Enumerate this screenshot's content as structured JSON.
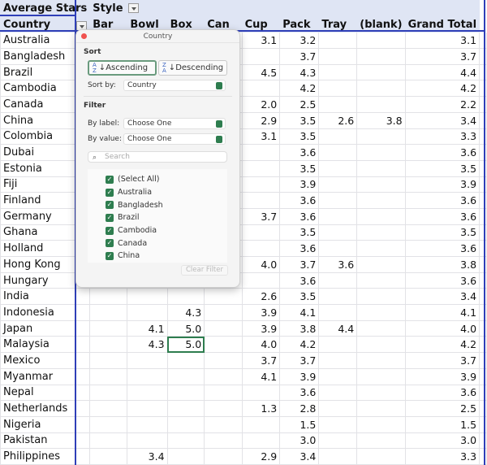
{
  "pivot": {
    "value_field": "Average Stars",
    "column_field": "Style",
    "row_field": "Country",
    "columns": [
      "Bar",
      "Bowl",
      "Box",
      "Can",
      "Cup",
      "Pack",
      "Tray",
      "(blank)",
      "Grand Total"
    ],
    "rows": [
      {
        "country": "Australia",
        "v": [
          "",
          "",
          "",
          "",
          "3.1",
          "3.2",
          "",
          "",
          "3.1"
        ]
      },
      {
        "country": "Bangladesh",
        "v": [
          "",
          "",
          "",
          "",
          "",
          "3.7",
          "",
          "",
          "3.7"
        ]
      },
      {
        "country": "Brazil",
        "v": [
          "",
          "",
          "",
          "",
          "4.5",
          "4.3",
          "",
          "",
          "4.4"
        ]
      },
      {
        "country": "Cambodia",
        "v": [
          "",
          "",
          "",
          "",
          "",
          "4.2",
          "",
          "",
          "4.2"
        ]
      },
      {
        "country": "Canada",
        "v": [
          "",
          "",
          "",
          "",
          "2.0",
          "2.5",
          "",
          "",
          "2.2"
        ]
      },
      {
        "country": "China",
        "v": [
          "",
          "",
          "",
          "",
          "2.9",
          "3.5",
          "2.6",
          "3.8",
          "3.4"
        ]
      },
      {
        "country": "Colombia",
        "v": [
          "",
          "",
          "",
          "",
          "3.1",
          "3.5",
          "",
          "",
          "3.3"
        ]
      },
      {
        "country": "Dubai",
        "v": [
          "",
          "",
          "",
          "",
          "",
          "3.6",
          "",
          "",
          "3.6"
        ]
      },
      {
        "country": "Estonia",
        "v": [
          "",
          "",
          "",
          "",
          "",
          "3.5",
          "",
          "",
          "3.5"
        ]
      },
      {
        "country": "Fiji",
        "v": [
          "",
          "",
          "",
          "",
          "",
          "3.9",
          "",
          "",
          "3.9"
        ]
      },
      {
        "country": "Finland",
        "v": [
          "",
          "",
          "",
          "",
          "",
          "3.6",
          "",
          "",
          "3.6"
        ]
      },
      {
        "country": "Germany",
        "v": [
          "",
          "",
          "",
          "",
          "3.7",
          "3.6",
          "",
          "",
          "3.6"
        ]
      },
      {
        "country": "Ghana",
        "v": [
          "",
          "",
          "",
          "",
          "",
          "3.5",
          "",
          "",
          "3.5"
        ]
      },
      {
        "country": "Holland",
        "v": [
          "",
          "",
          "",
          "",
          "",
          "3.6",
          "",
          "",
          "3.6"
        ]
      },
      {
        "country": "Hong Kong",
        "v": [
          "",
          "",
          "",
          "",
          "4.0",
          "3.7",
          "3.6",
          "",
          "3.8"
        ]
      },
      {
        "country": "Hungary",
        "v": [
          "",
          "",
          "",
          "",
          "",
          "3.6",
          "",
          "",
          "3.6"
        ]
      },
      {
        "country": "India",
        "v": [
          "",
          "",
          "",
          "",
          "2.6",
          "3.5",
          "",
          "",
          "3.4"
        ]
      },
      {
        "country": "Indonesia",
        "v": [
          "",
          "",
          "4.3",
          "",
          "3.9",
          "4.1",
          "",
          "",
          "4.1"
        ]
      },
      {
        "country": "Japan",
        "v": [
          "",
          "4.1",
          "5.0",
          "",
          "3.9",
          "3.8",
          "4.4",
          "",
          "4.0"
        ]
      },
      {
        "country": "Malaysia",
        "v": [
          "",
          "4.3",
          "5.0",
          "",
          "4.0",
          "4.2",
          "",
          "",
          "4.2"
        ]
      },
      {
        "country": "Mexico",
        "v": [
          "",
          "",
          "",
          "",
          "3.7",
          "3.7",
          "",
          "",
          "3.7"
        ]
      },
      {
        "country": "Myanmar",
        "v": [
          "",
          "",
          "",
          "",
          "4.1",
          "3.9",
          "",
          "",
          "3.9"
        ]
      },
      {
        "country": "Nepal",
        "v": [
          "",
          "",
          "",
          "",
          "",
          "3.6",
          "",
          "",
          "3.6"
        ]
      },
      {
        "country": "Netherlands",
        "v": [
          "",
          "",
          "",
          "",
          "1.3",
          "2.8",
          "",
          "",
          "2.5"
        ]
      },
      {
        "country": "Nigeria",
        "v": [
          "",
          "",
          "",
          "",
          "",
          "1.5",
          "",
          "",
          "1.5"
        ]
      },
      {
        "country": "Pakistan",
        "v": [
          "",
          "",
          "",
          "",
          "",
          "3.0",
          "",
          "",
          "3.0"
        ]
      },
      {
        "country": "Philippines",
        "v": [
          "",
          "3.4",
          "",
          "",
          "2.9",
          "3.4",
          "",
          "",
          "3.3"
        ]
      }
    ]
  },
  "popup": {
    "title": "Country",
    "sort_heading": "Sort",
    "ascending": "Ascending",
    "descending": "Descending",
    "sort_by_label": "Sort by:",
    "sort_by_value": "Country",
    "filter_heading": "Filter",
    "by_label": "By label:",
    "by_label_value": "Choose One",
    "by_value": "By value:",
    "by_value_value": "Choose One",
    "search_placeholder": "Search",
    "items": [
      "(Select All)",
      "Australia",
      "Bangladesh",
      "Brazil",
      "Cambodia",
      "Canada",
      "China"
    ],
    "clear_filter": "Clear Filter"
  },
  "colors": {
    "accent": "#2e7d4f",
    "pivot_border": "#2f3fb8",
    "header_bg": "#dfe5f4"
  }
}
